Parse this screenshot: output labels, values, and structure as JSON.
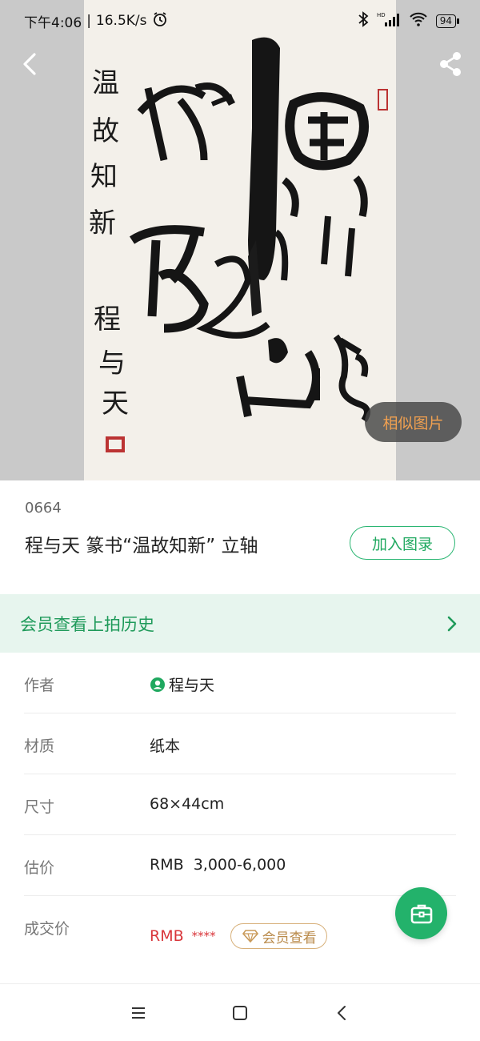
{
  "status_bar": {
    "time": "下午4:06",
    "speed": "16.5K/s",
    "network": "HD",
    "battery": "94",
    "icons": [
      "alarm-icon",
      "bluetooth-icon",
      "signal-icon",
      "wifi-icon",
      "battery-icon"
    ]
  },
  "hero": {
    "similar_label": "相似图片",
    "artwork_text": {
      "side_column": [
        "温",
        "故",
        "知",
        "新"
      ],
      "signature": [
        "程",
        "与",
        "天"
      ]
    }
  },
  "lot": {
    "number": "0664",
    "title": "程与天 篆书“温故知新” 立轴",
    "add_catalog_label": "加入图录"
  },
  "history": {
    "label": "会员查看上拍历史"
  },
  "details": [
    {
      "label": "作者",
      "value": "程与天"
    },
    {
      "label": "材质",
      "value": "纸本"
    },
    {
      "label": "尺寸",
      "value": "68×44cm"
    },
    {
      "label": "估价",
      "value": "RMB  3,000-6,000"
    }
  ],
  "deal_price": {
    "label": "成交价",
    "currency": "RMB",
    "masked": "****",
    "member_view_label": "会员查看"
  },
  "colors": {
    "accent_green": "#23b26b",
    "price_red": "#d9353a",
    "gold": "#b98a4a",
    "orange": "#f0a050"
  }
}
